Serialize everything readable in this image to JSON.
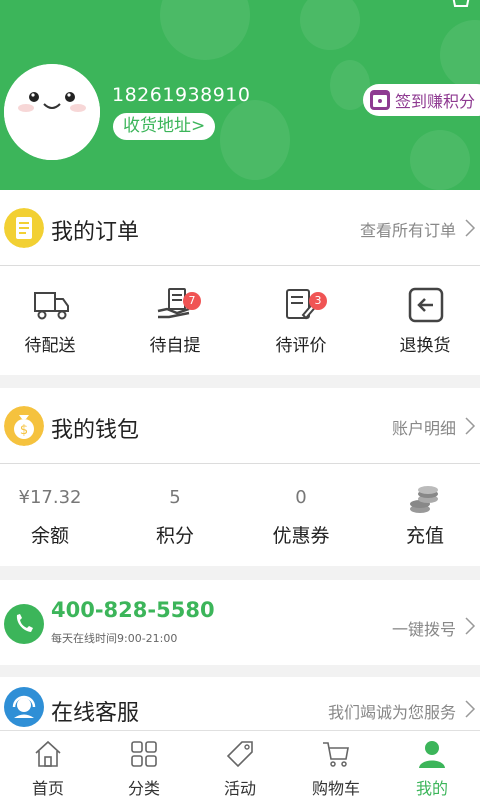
{
  "colors": {
    "brand": "#3cb55a",
    "badge": "#f05454",
    "checkin_text": "#8e3a91"
  },
  "profile": {
    "phone": "18261938910",
    "address_button": "收货地址>",
    "checkin_button": "签到赚积分"
  },
  "orders": {
    "title": "我的订单",
    "link": "查看所有订单",
    "items": [
      {
        "label": "待配送",
        "icon": "truck-icon"
      },
      {
        "label": "待自提",
        "icon": "pickup-icon",
        "badge": "7"
      },
      {
        "label": "待评价",
        "icon": "review-icon",
        "badge": "3"
      },
      {
        "label": "退换货",
        "icon": "return-icon"
      }
    ]
  },
  "wallet": {
    "title": "我的钱包",
    "link": "账户明细",
    "items": [
      {
        "value": "¥17.32",
        "label": "余额"
      },
      {
        "value": "5",
        "label": "积分"
      },
      {
        "value": "0",
        "label": "优惠券"
      },
      {
        "label": "充值",
        "icon": "coins-icon"
      }
    ]
  },
  "hotline": {
    "number": "400-828-5580",
    "hours": "每天在线时间9:00-21:00",
    "link": "一键拨号"
  },
  "service": {
    "title": "在线客服",
    "link": "我们竭诚为您服务"
  },
  "tabbar": [
    {
      "label": "首页",
      "icon": "home-icon"
    },
    {
      "label": "分类",
      "icon": "category-icon"
    },
    {
      "label": "活动",
      "icon": "tag-icon"
    },
    {
      "label": "购物车",
      "icon": "cart-icon"
    },
    {
      "label": "我的",
      "icon": "user-icon",
      "active": true
    }
  ]
}
